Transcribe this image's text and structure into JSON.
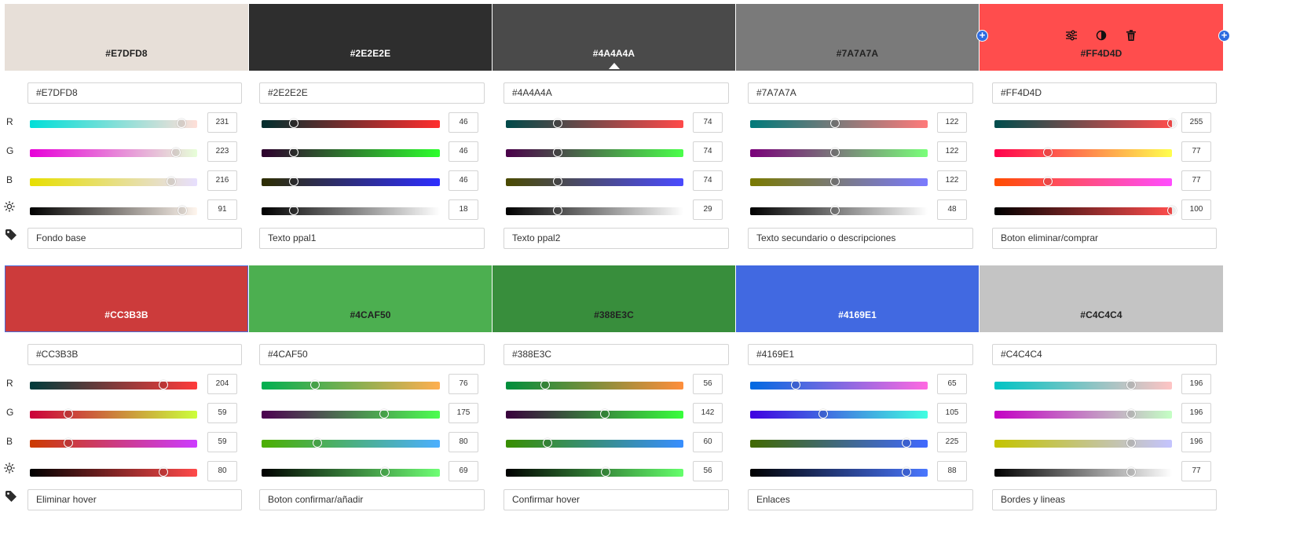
{
  "channel_labels": {
    "r": "R",
    "g": "G",
    "b": "B"
  },
  "icons": {
    "brightness": "sun-icon",
    "tag": "tag-icon",
    "adjust": "sliders-icon",
    "contrast": "contrast-icon",
    "delete": "trash-icon",
    "add": "plus-icon"
  },
  "rows": [
    {
      "colors": [
        {
          "hex": "#E7DFD8",
          "text_color": "#222222",
          "r": 231,
          "g": 223,
          "b": 216,
          "brightness": 91,
          "name": "Fondo base"
        },
        {
          "hex": "#2E2E2E",
          "text_color": "#ffffff",
          "r": 46,
          "g": 46,
          "b": 46,
          "brightness": 18,
          "name": "Texto ppal1"
        },
        {
          "hex": "#4A4A4A",
          "text_color": "#ffffff",
          "r": 74,
          "g": 74,
          "b": 74,
          "brightness": 29,
          "name": "Texto ppal2"
        },
        {
          "hex": "#7A7A7A",
          "text_color": "#222222",
          "r": 122,
          "g": 122,
          "b": 122,
          "brightness": 48,
          "name": "Texto secundario o descripciones"
        },
        {
          "hex": "#FF4D4D",
          "text_color": "#222222",
          "r": 255,
          "g": 77,
          "b": 77,
          "brightness": 100,
          "name": "Boton eliminar/comprar"
        }
      ]
    },
    {
      "colors": [
        {
          "hex": "#CC3B3B",
          "text_color": "#ffffff",
          "r": 204,
          "g": 59,
          "b": 59,
          "brightness": 80,
          "name": "Eliminar hover"
        },
        {
          "hex": "#4CAF50",
          "text_color": "#222222",
          "r": 76,
          "g": 175,
          "b": 80,
          "brightness": 69,
          "name": "Boton confirmar/añadir"
        },
        {
          "hex": "#388E3C",
          "text_color": "#222222",
          "r": 56,
          "g": 142,
          "b": 60,
          "brightness": 56,
          "name": "Confirmar hover"
        },
        {
          "hex": "#4169E1",
          "text_color": "#ffffff",
          "r": 65,
          "g": 105,
          "b": 225,
          "brightness": 88,
          "name": "Enlaces"
        },
        {
          "hex": "#C4C4C4",
          "text_color": "#222222",
          "r": 196,
          "g": 196,
          "b": 196,
          "brightness": 77,
          "name": "Bordes y lineas"
        }
      ]
    }
  ]
}
